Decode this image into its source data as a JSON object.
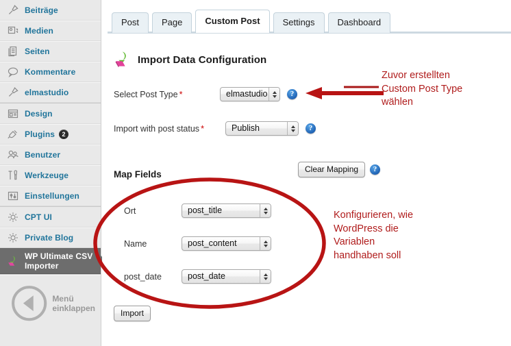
{
  "sidebar": {
    "groups": [
      {
        "items": [
          {
            "label": "Beiträge",
            "icon": "pin-icon",
            "name": "sidebar-item-beitraege"
          },
          {
            "label": "Medien",
            "icon": "media-icon",
            "name": "sidebar-item-medien"
          },
          {
            "label": "Seiten",
            "icon": "pages-icon",
            "name": "sidebar-item-seiten"
          },
          {
            "label": "Kommentare",
            "icon": "comment-icon",
            "name": "sidebar-item-kommentare"
          },
          {
            "label": "elmastudio",
            "icon": "pin-icon",
            "name": "sidebar-item-elmastudio"
          }
        ]
      },
      {
        "items": [
          {
            "label": "Design",
            "icon": "appearance-icon",
            "name": "sidebar-item-design"
          },
          {
            "label": "Plugins",
            "icon": "plugin-icon",
            "badge": "2",
            "name": "sidebar-item-plugins"
          },
          {
            "label": "Benutzer",
            "icon": "users-icon",
            "name": "sidebar-item-benutzer"
          },
          {
            "label": "Werkzeuge",
            "icon": "tools-icon",
            "name": "sidebar-item-werkzeuge"
          },
          {
            "label": "Einstellungen",
            "icon": "settings-icon",
            "name": "sidebar-item-einstellungen"
          }
        ]
      },
      {
        "items": [
          {
            "label": "CPT UI",
            "icon": "gear-icon",
            "name": "sidebar-item-cpt-ui"
          },
          {
            "label": "Private Blog",
            "icon": "gear-icon",
            "name": "sidebar-item-private-blog"
          },
          {
            "label": "WP Ultimate CSV Importer",
            "icon": "csv-import-icon",
            "active": true,
            "name": "sidebar-item-wp-ultimate-csv-importer"
          }
        ]
      }
    ],
    "collapse": {
      "label": "Menü einklappen",
      "icon": "collapse-arrow-icon"
    }
  },
  "tabs": [
    {
      "label": "Post",
      "active": false
    },
    {
      "label": "Page",
      "active": false
    },
    {
      "label": "Custom Post",
      "active": true
    },
    {
      "label": "Settings",
      "active": false
    },
    {
      "label": "Dashboard",
      "active": false
    }
  ],
  "page": {
    "title": "Import Data Configuration",
    "icon": "import-arrow-icon"
  },
  "form": {
    "post_type": {
      "label": "Select Post Type",
      "required": "*",
      "value": "elmastudio",
      "help": "?"
    },
    "post_status": {
      "label": "Import with post status",
      "required": "*",
      "value": "Publish",
      "help": "?"
    }
  },
  "map_fields": {
    "title": "Map Fields",
    "clear_button": "Clear Mapping",
    "help": "?",
    "rows": [
      {
        "label": "Ort",
        "value": "post_title"
      },
      {
        "label": "Name",
        "value": "post_content"
      },
      {
        "label": "post_date",
        "value": "post_date"
      }
    ]
  },
  "import_button": "Import",
  "annotations": {
    "arrow_note": "Zuvor erstellten\nCustom Post Type\nwählen",
    "ellipse_note": "Konfigurieren, wie\nWordPress die\nVariablen\nhandhaben soll",
    "color": "#b01c1c"
  }
}
